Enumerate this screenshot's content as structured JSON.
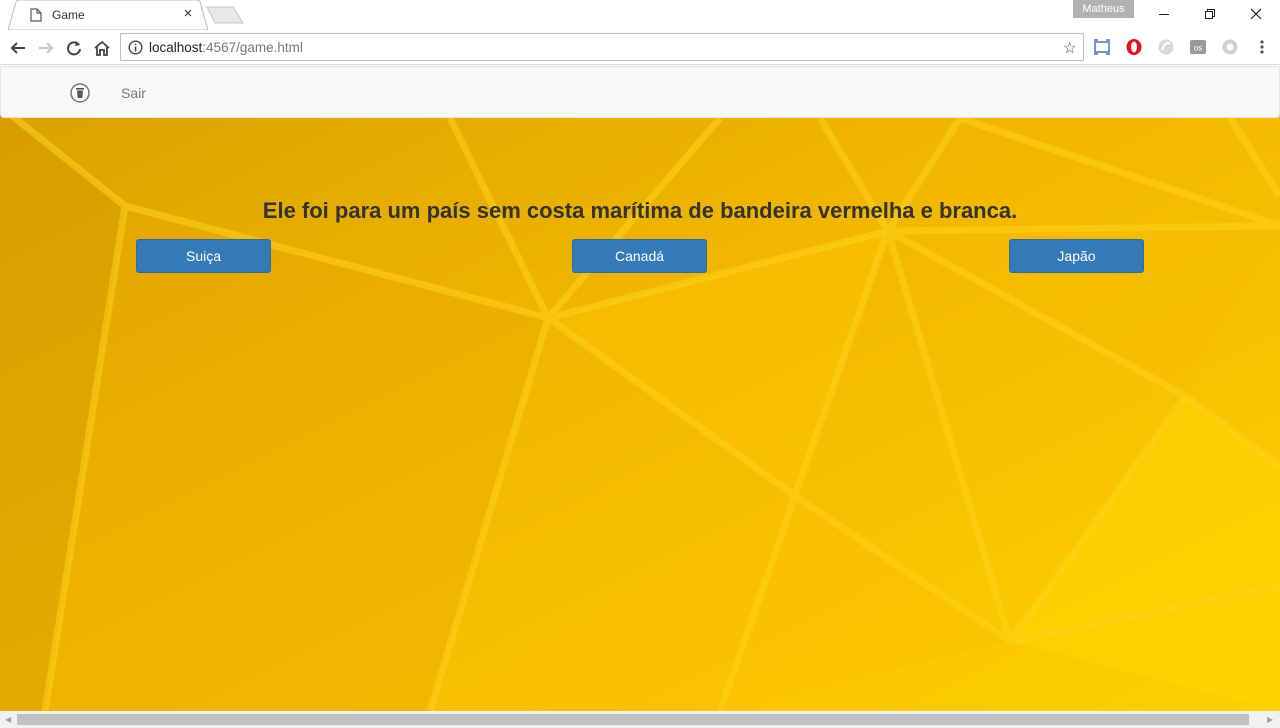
{
  "browser": {
    "tab_title": "Game",
    "tab_close": "×",
    "profile_name": "Matheus",
    "url_host": "localhost",
    "url_rest": ":4567/game.html",
    "bookmark_star": "☆"
  },
  "navbar": {
    "logout_label": "Sair"
  },
  "game": {
    "question": "Ele foi para um país sem costa marítima de bandeira vermelha e branca.",
    "options": [
      "Suiça",
      "Canadá",
      "Japão"
    ]
  },
  "colors": {
    "primary_button": "#337ab7",
    "background_yellow": "#f6bc00",
    "navbar_bg": "#f8f8f8"
  }
}
